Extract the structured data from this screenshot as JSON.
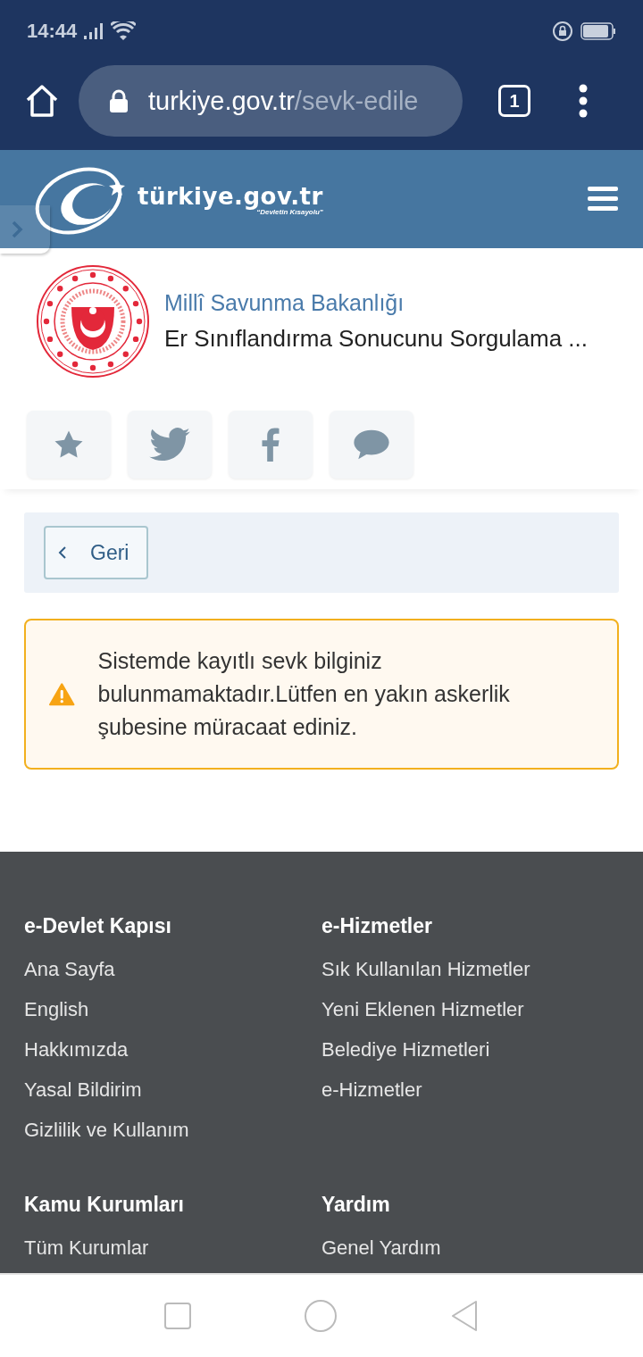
{
  "status_bar": {
    "time": "14:44"
  },
  "browser": {
    "url_host": "turkiye.gov.tr",
    "url_path": "/sevk-edile",
    "tab_count": "1"
  },
  "site_header": {
    "logo_name": "türkiye.gov.tr",
    "logo_slogan": "“Devletin Kısayolu”"
  },
  "agency": {
    "name": "Millî Savunma Bakanlığı",
    "service": "Er Sınıflandırma Sonucunu Sorgulama ..."
  },
  "actions": [
    {
      "kind": "star"
    },
    {
      "kind": "twitter"
    },
    {
      "kind": "facebook"
    },
    {
      "kind": "comment"
    }
  ],
  "back_button": {
    "label": "Geri"
  },
  "alert": {
    "kind": "warning",
    "message": "Sistemde kayıtlı sevk bilginiz bulunmamaktadır.Lütfen en yakın askerlik şubesine müracaat ediniz."
  },
  "footer": {
    "sections": [
      {
        "title": "e-Devlet Kapısı",
        "links": [
          "Ana Sayfa",
          "English",
          "Hakkımızda",
          "Yasal Bildirim",
          "Gizlilik ve Kullanım"
        ]
      },
      {
        "title": "e-Hizmetler",
        "links": [
          "Sık Kullanılan Hizmetler",
          "Yeni Eklenen Hizmetler",
          "Belediye Hizmetleri",
          "e-Hizmetler"
        ]
      },
      {
        "title": "Kamu Kurumları",
        "links": [
          "Tüm Kurumlar"
        ]
      },
      {
        "title": "Yardım",
        "links": [
          "Genel Yardım"
        ]
      }
    ]
  }
}
